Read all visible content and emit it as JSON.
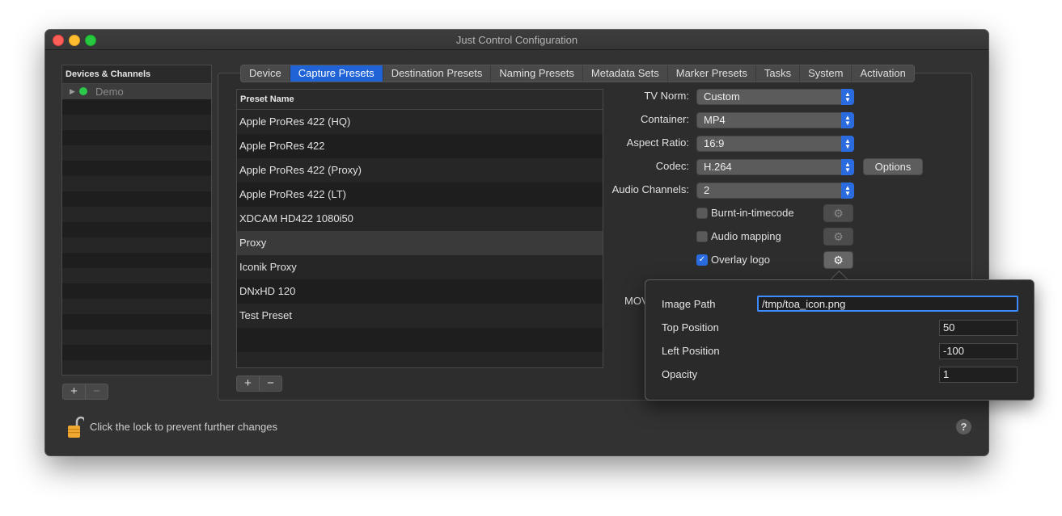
{
  "window": {
    "title": "Just Control Configuration"
  },
  "devices": {
    "header": "Devices & Channels",
    "items": [
      {
        "label": "Demo",
        "status_color": "#2cc84a"
      }
    ],
    "add_label": "+",
    "remove_label": "−"
  },
  "tabs": [
    {
      "label": "Device"
    },
    {
      "label": "Capture Presets",
      "active": true
    },
    {
      "label": "Destination Presets"
    },
    {
      "label": "Naming Presets"
    },
    {
      "label": "Metadata Sets"
    },
    {
      "label": "Marker Presets"
    },
    {
      "label": "Tasks"
    },
    {
      "label": "System"
    },
    {
      "label": "Activation"
    }
  ],
  "presets": {
    "column_header": "Preset Name",
    "rows": [
      "Apple ProRes 422 (HQ)",
      "Apple ProRes 422",
      "Apple ProRes 422 (Proxy)",
      "Apple ProRes 422 (LT)",
      "XDCAM HD422 1080i50",
      "Proxy",
      "Iconik Proxy",
      "DNxHD 120",
      "Test Preset"
    ],
    "selected": "Proxy",
    "add_label": "+",
    "remove_label": "−"
  },
  "form": {
    "tv_norm": {
      "label": "TV Norm:",
      "value": "Custom"
    },
    "container": {
      "label": "Container:",
      "value": "MP4"
    },
    "aspect_ratio": {
      "label": "Aspect Ratio:",
      "value": "16:9"
    },
    "codec": {
      "label": "Codec:",
      "value": "H.264",
      "options_button": "Options"
    },
    "audio_channels": {
      "label": "Audio Channels:",
      "value": "2"
    },
    "burnt_in_timecode": {
      "label": "Burnt-in-timecode",
      "checked": false
    },
    "audio_mapping": {
      "label": "Audio mapping",
      "checked": false
    },
    "overlay_logo": {
      "label": "Overlay logo",
      "checked": true
    },
    "mov_partial": "MOV"
  },
  "overlay_popover": {
    "image_path": {
      "label": "Image Path",
      "value": "/tmp/toa_icon.png"
    },
    "top_position": {
      "label": "Top Position",
      "value": "50"
    },
    "left_position": {
      "label": "Left Position",
      "value": "-100"
    },
    "opacity": {
      "label": "Opacity",
      "value": "1"
    }
  },
  "footer": {
    "lock_text": "Click the lock to prevent further changes",
    "help_label": "?"
  },
  "colors": {
    "accent": "#1f63d6",
    "window_bg": "#323232",
    "lock": "#f0a830"
  }
}
